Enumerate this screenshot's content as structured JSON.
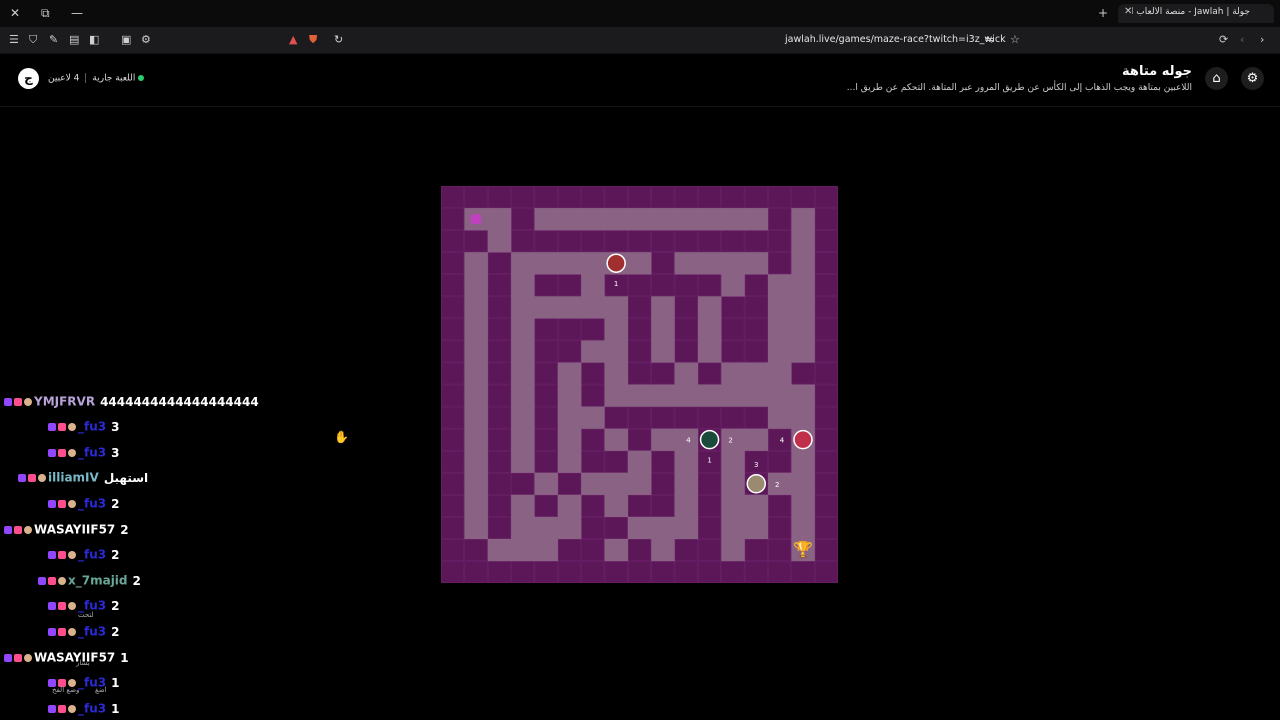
{
  "browser": {
    "tab_title": "جولة | Jawlah - منصة الألعاب التفا",
    "url": "jawlah.live/games/maze-race?twitch=i3z_wick"
  },
  "header": {
    "logo_icon": "jawlah-logo-icon",
    "title": "جوله متاهة",
    "description": "اللاعبين بمتاهة ويجب الذهاب إلى الكأس عن طريق المرور عبر المتاهة. التحكم عن طريق ا...",
    "players_count": "4 لاعبين",
    "game_status": "اللعبة جارية",
    "status_color": "#2ecc71"
  },
  "maze": {
    "wall_color": "#5b1758",
    "path_color": "#8a6284",
    "grid": [
      "#################",
      "#S.#..........#.#",
      "##.############.#",
      "#.#......#....#.#",
      "#.#.##.#####.#..#",
      "#.#.....#.#.##..#",
      "#.#.###.#.#.##..#",
      "#.#.##..#.#.##..#",
      "#.#.#.#.##.#...##",
      "#.#.#.#.........#",
      "#.#.#..#######..#",
      "#.#.#.#.#..#..#.#",
      "#.#.#.##.#.#.##.#",
      "#.##.#...#.#.#..#",
      "#.#.#.#.##.#..#.#",
      "#.#...##...#..#.#",
      "##...##.#.##.##T#",
      "#################"
    ],
    "players": [
      {
        "label": "1",
        "color": "#a03030"
      },
      {
        "label": "4",
        "color": "#1a4a3a"
      },
      {
        "label": "4",
        "color": "#c0304a"
      },
      {
        "label": "3",
        "color": "#9a8a70"
      }
    ],
    "move_numbers": [
      "1",
      "4",
      "2",
      "4",
      "1",
      "3",
      "2"
    ],
    "trophy_icon": "trophy-icon"
  },
  "chat": {
    "messages": [
      {
        "name": "YMJFRVR",
        "text": "4444444444444444444",
        "name_color": "#b9a3d8"
      },
      {
        "name": "_fu3",
        "text": "3",
        "name_color": "#2a2ad8"
      },
      {
        "name": "_fu3",
        "text": "3",
        "name_color": "#2a2ad8"
      },
      {
        "name": "illiamIV",
        "text": "استهبل",
        "name_color": "#7ab8c8"
      },
      {
        "name": "_fu3",
        "text": "2",
        "name_color": "#2a2ad8"
      },
      {
        "name": "WASAYIIF57",
        "text": "2",
        "name_color": "#ffffff"
      },
      {
        "name": "_fu3",
        "text": "2",
        "name_color": "#2a2ad8"
      },
      {
        "name": "x_7majid",
        "text": "2",
        "name_color": "#6aa89a"
      },
      {
        "name": "_fu3",
        "text": "2",
        "name_color": "#2a2ad8"
      },
      {
        "name": "_fu3",
        "text": "2",
        "name_color": "#2a2ad8"
      },
      {
        "name": "WASAYIIF57",
        "text": "1",
        "name_color": "#ffffff"
      },
      {
        "name": "_fu3",
        "text": "1",
        "name_color": "#2a2ad8"
      },
      {
        "name": "_fu3",
        "text": "1",
        "name_color": "#2a2ad8"
      }
    ],
    "overlay_hints": [
      "لتحت",
      "يسار",
      "وضع الفخ",
      "اضغ"
    ]
  }
}
